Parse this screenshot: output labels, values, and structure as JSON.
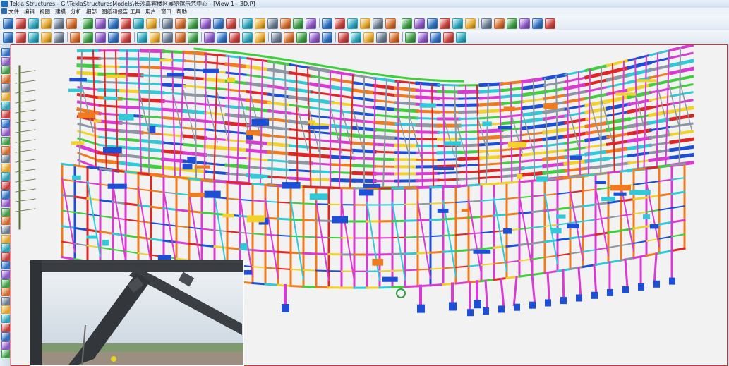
{
  "window": {
    "title": "Tekla Structures - G:\\TeklaStructuresModels\\长沙嘉宾楼区展览馆示范中心 - [View 1 - 3D,P]"
  },
  "menu": {
    "items": [
      "文件",
      "编辑",
      "视图",
      "建模",
      "分析",
      "细部",
      "图纸和报告",
      "工具",
      "用户",
      "窗口",
      "帮助"
    ]
  },
  "toolbar_row1": {
    "icons": [
      "new-icon",
      "open-icon",
      "save-icon",
      "undo-icon",
      "redo-icon",
      "copy-icon",
      "move-icon",
      "delete-icon",
      "select-all-icon",
      "filter-icon",
      "view-icon",
      "view-list-icon",
      "properties-icon",
      "snap-icon",
      "beam-icon",
      "column-icon",
      "plate-icon",
      "bolt-icon",
      "weld-icon",
      "grid-icon",
      "render-icon",
      "wire-icon",
      "line-icon",
      "polyline-icon",
      "arc-icon",
      "curve-icon",
      "arrow-icon",
      "point-icon",
      "dimension-icon",
      "text-icon",
      "cloud-icon",
      "mirror-icon",
      "measure-icon",
      "zoom-icon",
      "pan-icon",
      "rotate-icon",
      "clash-icon",
      "report-icon",
      "drawing-icon",
      "numbering-icon",
      "sync-icon",
      "help-icon"
    ]
  },
  "toolbar_row2": {
    "icons": [
      "component-icon",
      "catalog-icon",
      "connection-icon",
      "detail-icon",
      "seam-icon",
      "part-icon",
      "assembly-icon",
      "cast-unit-icon",
      "rebar-icon",
      "pour-icon",
      "reference-icon",
      "phase-icon",
      "lot-icon",
      "organizer-icon",
      "query-icon",
      "inquire-icon",
      "compare-icon",
      "status-icon",
      "column-tool-icon",
      "beam-tool-icon",
      "polybeam-icon",
      "curved-beam-icon",
      "twin-profile-icon",
      "contour-plate-icon",
      "slab-icon",
      "panel-icon",
      "pad-footing-icon",
      "strip-footing-icon",
      "snap-end-icon",
      "snap-mid-icon",
      "snap-intersect-icon",
      "snap-perp-icon",
      "snap-any-icon",
      "snap-line-icon",
      "snap-point-icon"
    ]
  },
  "left_toolbar": {
    "icons": [
      "select-icon",
      "zoom-icon",
      "rotate-icon",
      "pan-icon",
      "next-icon",
      "prev-icon",
      "column-icon",
      "beam-icon",
      "plate-icon",
      "weld-icon",
      "bolt-icon",
      "grid-icon",
      "level-icon",
      "cut-icon",
      "fit-icon",
      "split-icon",
      "combine-icon",
      "attach-icon",
      "detach-icon",
      "snap-icon",
      "point-icon",
      "line-icon",
      "plane-icon",
      "work-area-icon",
      "clip-icon",
      "hide-icon",
      "show-icon",
      "layer-icon",
      "color-icon",
      "render-icon",
      "measure-icon",
      "dim-icon",
      "mark-icon",
      "note-icon",
      "exit-icon"
    ]
  },
  "colors": {
    "view_border": "#d23030",
    "view_background": "#f2f2f2",
    "member_magenta": "#d93ad2",
    "member_blue": "#1c4fd6",
    "member_orange": "#f07a1c",
    "member_cyan": "#2fc9d8",
    "member_green": "#3fcf3c",
    "member_red": "#e02525",
    "member_yellow": "#f2d22a",
    "member_steel": "#8d96a3"
  }
}
